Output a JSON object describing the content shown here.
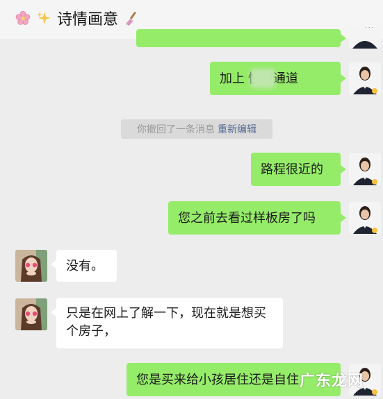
{
  "header": {
    "title": "诗情画意",
    "more": "..."
  },
  "system_message": {
    "text": "你撤回了一条消息",
    "link": "重新编辑"
  },
  "messages": [
    {
      "side": "right",
      "text": "加上 快速通道"
    },
    {
      "side": "right",
      "text": "路程很近的"
    },
    {
      "side": "right",
      "text": "您之前去看过样板房了吗"
    },
    {
      "side": "left",
      "text": "没有。"
    },
    {
      "side": "left",
      "text": "只是在网上了解一下，现在就是想买个房子，"
    },
    {
      "side": "right",
      "text": "您是买来给小孩居住还是自住"
    }
  ],
  "watermark": "广东龙网",
  "colors": {
    "me_bubble": "#95ec69",
    "them_bubble": "#ffffff",
    "chat_bg": "#ededed",
    "link": "#576b95"
  }
}
